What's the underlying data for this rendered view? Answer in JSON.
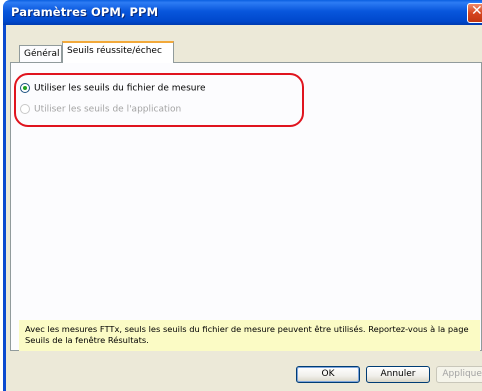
{
  "window": {
    "title": "Paramètres OPM, PPM",
    "close_glyph": "✕"
  },
  "tabs": [
    {
      "label": "Général",
      "active": false
    },
    {
      "label": "Seuils réussite/échec",
      "active": true
    }
  ],
  "options": [
    {
      "label": "Utiliser les seuils du fichier de mesure",
      "selected": true,
      "enabled": true
    },
    {
      "label": "Utiliser les seuils de l'application",
      "selected": false,
      "enabled": false
    }
  ],
  "info_text": "Avec les mesures FTTx, seuls les seuils du fichier de mesure peuvent être utilisés. Reportez-vous à la page Seuils de la fenêtre Résultats.",
  "buttons": {
    "ok": "OK",
    "cancel": "Annuler",
    "apply": "Appliquer"
  },
  "colors": {
    "titlebar": "#0054e3",
    "highlight": "#e0141e",
    "info_bg": "#fbfbc5"
  }
}
